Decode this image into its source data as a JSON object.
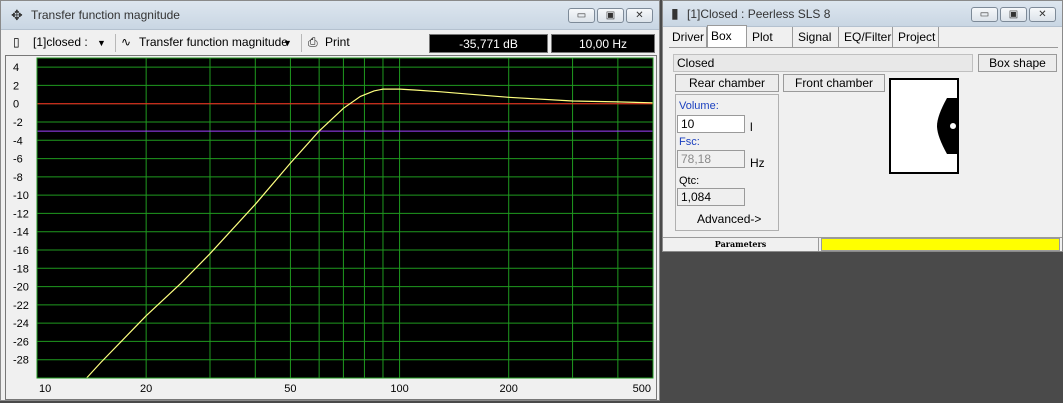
{
  "tf_window": {
    "title": "Transfer function magnitude",
    "controls": {
      "minimize": "▭",
      "maximize": "▣",
      "close": "✕"
    },
    "toolbar": {
      "project_select": "[1]closed :",
      "graph_select": "Transfer function magnitude",
      "print_label": "Print",
      "readout_db": "-35,771 dB",
      "readout_hz": "10,00 Hz"
    },
    "icons": {
      "window_icon": "crosshair-icon",
      "graph_icon": "wave-icon",
      "print_icon": "printer-icon"
    }
  },
  "chart_data": {
    "type": "line",
    "title": "",
    "xlabel": "",
    "ylabel": "",
    "x_scale": "log",
    "xlim": [
      10,
      500
    ],
    "ylim": [
      -30,
      5
    ],
    "grid": true,
    "x_ticks": [
      "10",
      "20",
      "50",
      "100",
      "200",
      "500"
    ],
    "y_ticks": [
      "4",
      "2",
      "0",
      "-2",
      "-4",
      "-6",
      "-8",
      "-10",
      "-12",
      "-14",
      "-16",
      "-18",
      "-20",
      "-22",
      "-24",
      "-26",
      "-28"
    ],
    "reference_lines": [
      {
        "y": 0,
        "color": "#ff2020"
      },
      {
        "y": -3,
        "color": "#a040ff"
      }
    ],
    "series": [
      {
        "color": "#ffff80",
        "x": [
          13.7,
          15,
          20,
          25,
          30,
          40,
          50,
          60,
          70,
          78,
          85,
          90,
          100,
          110,
          130,
          150,
          200,
          300,
          400,
          500
        ],
        "y": [
          -30,
          -28.3,
          -23.2,
          -19.6,
          -16.4,
          -11.0,
          -6.5,
          -3.0,
          -0.5,
          0.8,
          1.4,
          1.6,
          1.6,
          1.5,
          1.3,
          1.1,
          0.7,
          0.3,
          0.2,
          0.1
        ]
      }
    ]
  },
  "box_window": {
    "title": "[1]Closed : Peerless SLS 8",
    "tabs": [
      "Driver",
      "Box",
      "Plot",
      "Signal",
      "EQ/Filter",
      "Project"
    ],
    "active_tab": "Box",
    "box_type": "Closed",
    "box_shape_button": "Box shape",
    "rear_chamber_button": "Rear chamber",
    "front_chamber_button": "Front chamber",
    "volume_label": "Volume:",
    "volume_value": "10",
    "volume_unit": "l",
    "fsc_label": "Fsc:",
    "fsc_value": "78,18",
    "fsc_unit": "Hz",
    "qtc_label": "Qtc:",
    "qtc_value": "1,084",
    "advanced_button": "Advanced->",
    "status_label": "Parameters",
    "status_color": "#ffff00",
    "accent_label_color": "#1a3fbf"
  }
}
